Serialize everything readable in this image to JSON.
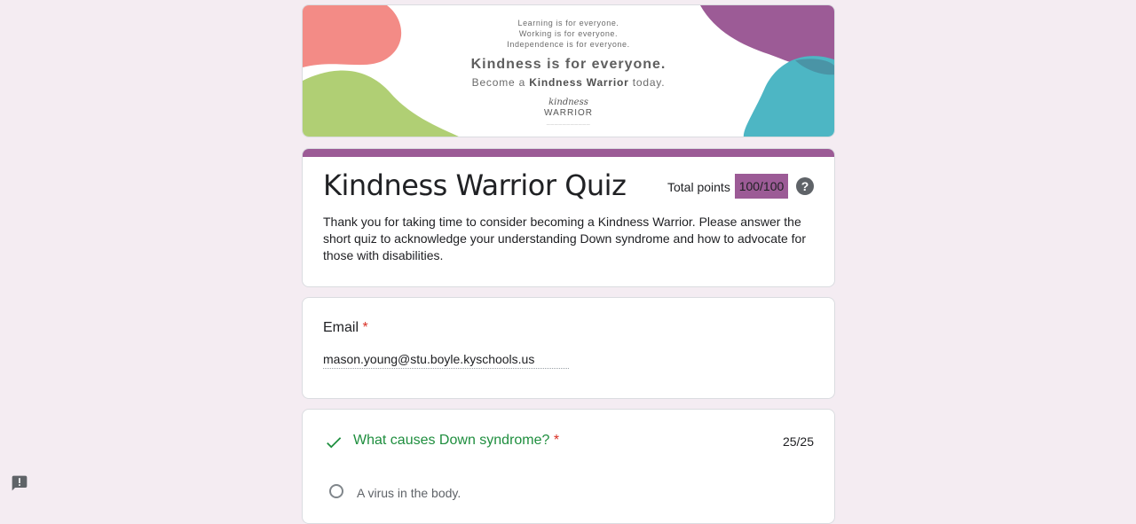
{
  "banner": {
    "line1": "Learning is for everyone.",
    "line2": "Working is for everyone.",
    "line3": "Independence is for everyone.",
    "headline": "Kindness is for everyone.",
    "sub_prefix": "Become a ",
    "sub_bold": "Kindness Warrior",
    "sub_suffix": " today.",
    "logo_script": "kindness",
    "logo_word": "WARRIOR",
    "colors": {
      "coral": "#f38b86",
      "green": "#b0cf74",
      "purple": "#9c5b96",
      "teal": "#4db6c4"
    }
  },
  "form": {
    "title": "Kindness Warrior Quiz",
    "points_label": "Total points",
    "points_value": "100/100",
    "description": "Thank you for taking time to consider becoming a Kindness Warrior. Please answer the short quiz to acknowledge your understanding Down syndrome and how to advocate for those with disabilities.",
    "accent_color": "#9c5b96"
  },
  "email": {
    "label": "Email",
    "required_mark": "*",
    "value": "mason.young@stu.boyle.kyschools.us"
  },
  "question1": {
    "title": "What causes Down syndrome?",
    "required_mark": "*",
    "score": "25/25",
    "options": [
      "A virus in the body."
    ],
    "status_color": "#1e8e3e"
  },
  "icons": {
    "help": "help-circle-icon",
    "check": "check-icon",
    "report": "report-problem-icon"
  }
}
